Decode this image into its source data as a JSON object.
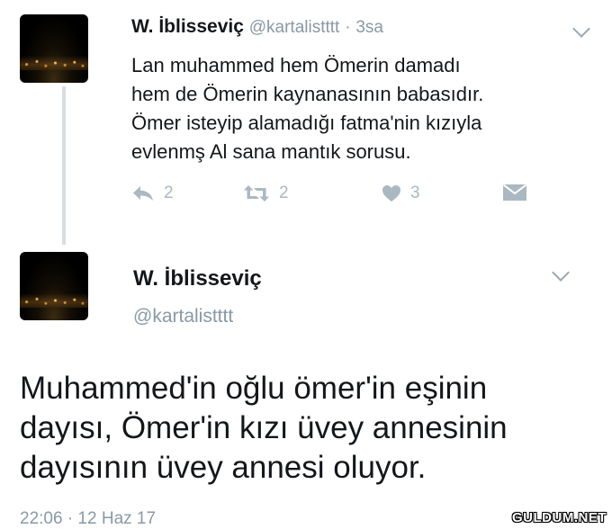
{
  "tweet1": {
    "name": "W. İblisseviç",
    "handle": "@kartalistttt",
    "dot": "·",
    "time": "3sa",
    "lines": [
      "Lan muhammed hem Ömerin damadı",
      "hem de Ömerin kaynanasının babasıdır.",
      "Ömer isteyip alamadığı fatma'nin kızıyla",
      "evlenmş Al sana mantık sorusu."
    ],
    "actions": {
      "reply_count": "2",
      "retweet_count": "2",
      "like_count": "3"
    }
  },
  "tweet2": {
    "name": "W. İblisseviç",
    "handle": "@kartalistttt",
    "lines": [
      "Muhammed'in oğlu ömer'in eşinin",
      "dayısı, Ömer'in kızı üvey annesinin",
      "dayısının üvey annesi oluyor."
    ],
    "timestamp": "22:06 · 12 Haz 17"
  },
  "watermark": "GULDUM.NET",
  "icons": {
    "reply": "reply-icon",
    "retweet": "retweet-icon",
    "like": "heart-icon",
    "dm": "envelope-icon",
    "menu": "chevron-down-icon"
  },
  "colors": {
    "secondary_text": "#8899a6",
    "action_icon": "#aab8c2",
    "thread_line": "#d8dde2"
  }
}
